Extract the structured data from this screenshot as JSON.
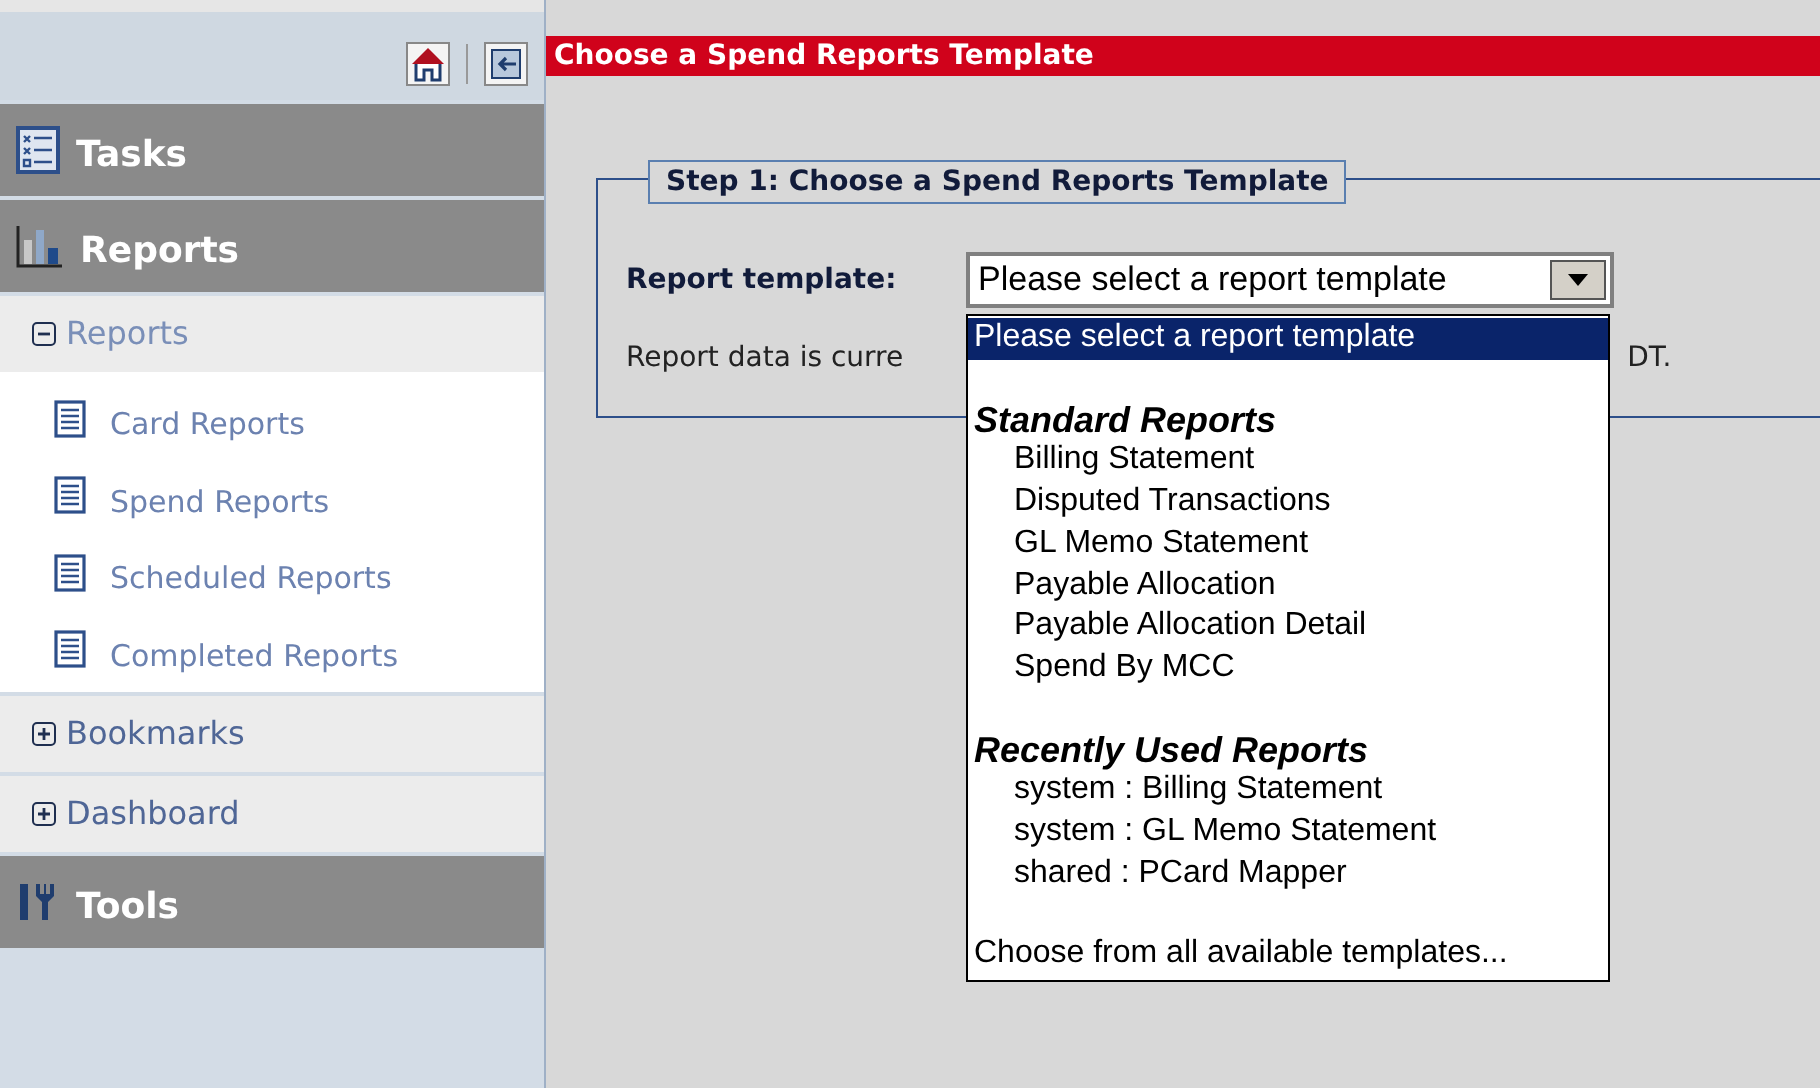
{
  "page_title": "Choose a Spend Reports Template",
  "sidebar": [
    {
      "kind": "header",
      "label": "Tasks"
    },
    {
      "kind": "header",
      "label": "Reports"
    },
    {
      "kind": "subsection",
      "label": "Reports",
      "expanded": true,
      "items": [
        "Card Reports",
        "Spend Reports",
        "Scheduled Reports",
        "Completed Reports"
      ]
    },
    {
      "kind": "subsection",
      "label": "Bookmarks",
      "expanded": false
    },
    {
      "kind": "subsection",
      "label": "Dashboard",
      "expanded": false
    },
    {
      "kind": "header",
      "label": "Tools"
    }
  ],
  "step": {
    "legend": "Step 1: Choose a Spend Reports Template",
    "field_label": "Report template:",
    "value": "Please select a report template",
    "note_before": "Report data is curre",
    "note_after": "DT.",
    "options": [
      {
        "kind": "option",
        "label": "Please select a report template",
        "selected": true
      },
      {
        "kind": "group",
        "label": "Standard Reports",
        "selected": false
      },
      {
        "kind": "option",
        "label": "Billing Statement",
        "selected": false
      },
      {
        "kind": "option",
        "label": "Disputed Transactions",
        "selected": false
      },
      {
        "kind": "option",
        "label": "GL Memo Statement",
        "selected": false
      },
      {
        "kind": "option",
        "label": "Payable Allocation",
        "selected": false
      },
      {
        "kind": "option",
        "label": "Payable Allocation Detail",
        "selected": false
      },
      {
        "kind": "option",
        "label": "Spend By MCC",
        "selected": false
      },
      {
        "kind": "group",
        "label": "Recently Used Reports",
        "selected": false
      },
      {
        "kind": "option",
        "label": "system : Billing Statement",
        "selected": false
      },
      {
        "kind": "option",
        "label": "system : GL Memo Statement",
        "selected": false
      },
      {
        "kind": "option",
        "label": "shared : PCard Mapper",
        "selected": false
      },
      {
        "kind": "action",
        "label": "Choose from all available templates...",
        "selected": false
      }
    ]
  }
}
